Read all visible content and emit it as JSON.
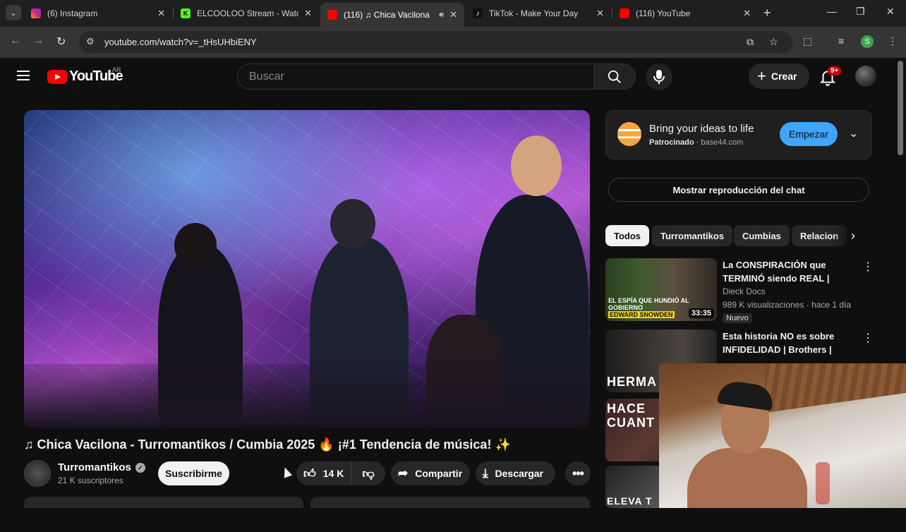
{
  "browser": {
    "tabs": [
      {
        "title": "(6) Instagram",
        "icon": "instagram-icon"
      },
      {
        "title": "ELCOOLOO Stream - Watch",
        "icon": "kick-icon"
      },
      {
        "title": "(116) ♫ Chica Vacilona",
        "icon": "youtube-icon",
        "active": true
      },
      {
        "title": "TikTok - Make Your Day",
        "icon": "tiktok-icon"
      },
      {
        "title": "(116) YouTube",
        "icon": "youtube-icon"
      }
    ],
    "url": "youtube.com/watch?v=_tHsUHbiENY",
    "profile_initial": "S"
  },
  "youtube": {
    "logo_text": "YouTube",
    "country_code": "AR",
    "search_placeholder": "Buscar",
    "create_label": "Crear",
    "notification_count": "9+"
  },
  "video": {
    "title": "♫ Chica Vacilona - Turromantikos / Cumbia 2025 🔥 ¡#1 Tendencia de música! ✨",
    "channel": "Turromantikos",
    "subscribers": "21 K suscriptores",
    "subscribe_label": "Suscribirme",
    "likes": "14 K",
    "share_label": "Compartir",
    "download_label": "Descargar"
  },
  "ad": {
    "title": "Bring your ideas to life",
    "sponsored": "Patrocinado",
    "domain": "base44.com",
    "cta": "Empezar"
  },
  "chat_button": "Mostrar reproducción del chat",
  "chips": [
    "Todos",
    "Turromantikos",
    "Cumbias",
    "Relacion"
  ],
  "recommendations": [
    {
      "title": "La CONSPIRACIÓN que TERMINÓ siendo REAL | Edwa...",
      "channel": "Dieck Docs",
      "views": "989 K visualizaciones · hace 1 día",
      "badge": "Nuevo",
      "duration": "33:35",
      "thumb_caption_1": "EL ESPÍA QUE HUNDIÓ AL GOBIERNO",
      "thumb_caption_2": "EDWARD SNOWDEN"
    },
    {
      "title": "Esta historia NO es sobre INFIDELIDAD | Brothers | Relat...",
      "thumb_caption": "HERMA"
    },
    {
      "thumb_caption": "HACE CUANT"
    },
    {
      "thumb_caption": "ELEVA T"
    }
  ]
}
